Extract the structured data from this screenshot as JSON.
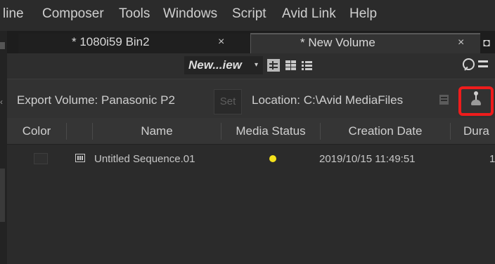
{
  "menu": {
    "items": [
      "line",
      "Composer",
      "Tools",
      "Windows",
      "Script",
      "Avid Link",
      "Help"
    ]
  },
  "tabs": {
    "bin_tab_label": "* 1080i59 Bin2",
    "bin_tab_close": "×",
    "volume_tab_label": "* New Volume",
    "volume_tab_close": "×"
  },
  "view": {
    "selected_view": "New...iew",
    "arrow": "▾"
  },
  "export": {
    "label": "Export Volume: Panasonic P2",
    "set_button": "Set",
    "location": "Location: C:\\Avid MediaFiles"
  },
  "table": {
    "columns": [
      "Color",
      "",
      "Name",
      "Media Status",
      "Creation Date",
      "Dura"
    ],
    "rows": [
      {
        "name": "Untitled Sequence.01",
        "media_status_color": "#f4e21c",
        "creation_date": "2019/10/15 11:49:51",
        "duration": "1"
      }
    ]
  },
  "colors": {
    "highlight": "#ee1c1c",
    "panel_bg": "#2e2e2e",
    "status_online": "#f4e21c"
  }
}
